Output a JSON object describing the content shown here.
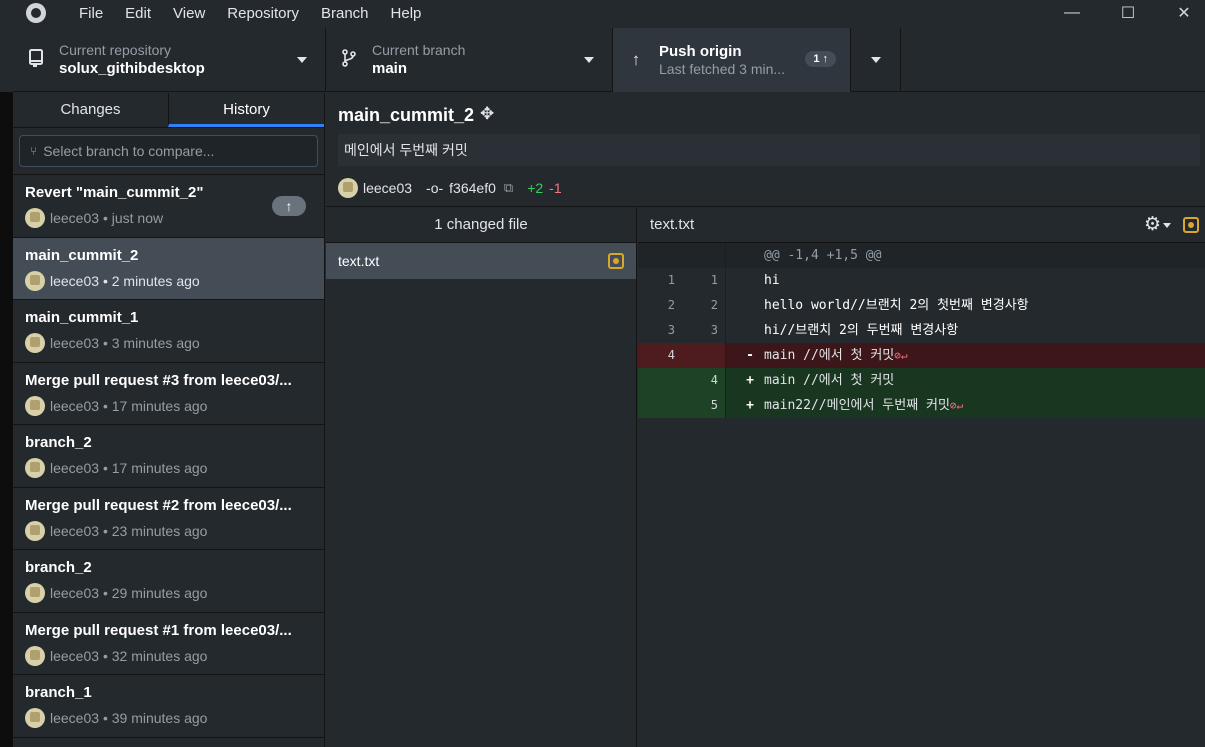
{
  "menu": [
    "File",
    "Edit",
    "View",
    "Repository",
    "Branch",
    "Help"
  ],
  "window_controls": {
    "minimize": "—",
    "maximize": "☐",
    "close": "✕"
  },
  "toolbar": {
    "repo_label": "Current repository",
    "repo_name": "solux_githibdesktop",
    "branch_label": "Current branch",
    "branch_name": "main",
    "push_label": "Push origin",
    "push_sub": "Last fetched 3 min...",
    "push_count": "1 ↑"
  },
  "sidebar": {
    "tabs": [
      "Changes",
      "History"
    ],
    "active_tab": "History",
    "compare_placeholder": "Select branch to compare...",
    "commits": [
      {
        "title": "Revert \"main_cummit_2\"",
        "author": "leece03",
        "time": "• just now",
        "unpushed": true
      },
      {
        "title": "main_cummit_2",
        "author": "leece03",
        "time": "• 2 minutes ago",
        "selected": true
      },
      {
        "title": "main_cummit_1",
        "author": "leece03",
        "time": "• 3 minutes ago"
      },
      {
        "title": "Merge pull request #3 from leece03/...",
        "author": "leece03",
        "time": "• 17 minutes ago"
      },
      {
        "title": "branch_2",
        "author": "leece03",
        "time": "• 17 minutes ago"
      },
      {
        "title": "Merge pull request #2 from leece03/...",
        "author": "leece03",
        "time": "• 23 minutes ago"
      },
      {
        "title": "branch_2",
        "author": "leece03",
        "time": "• 29 minutes ago"
      },
      {
        "title": "Merge pull request #1 from leece03/...",
        "author": "leece03",
        "time": "• 32 minutes ago"
      },
      {
        "title": "branch_1",
        "author": "leece03",
        "time": "• 39 minutes ago"
      }
    ]
  },
  "commit": {
    "title": "main_cummit_2",
    "description": "메인에서 두번째 커밋",
    "author": "leece03",
    "sha": "f364ef0",
    "additions": "+2",
    "deletions": "-1"
  },
  "files": {
    "header": "1 changed file",
    "items": [
      "text.txt"
    ]
  },
  "diff": {
    "filename": "text.txt",
    "lines": [
      {
        "type": "hunk",
        "old": "",
        "new": "",
        "sign": "",
        "text": "@@ -1,4 +1,5 @@",
        "nl": ""
      },
      {
        "type": "ctx",
        "old": "1",
        "new": "1",
        "sign": "",
        "text": "hi",
        "nl": ""
      },
      {
        "type": "ctx",
        "old": "2",
        "new": "2",
        "sign": "",
        "text": "hello world//브랜치 2의 첫번째 변경사항",
        "nl": ""
      },
      {
        "type": "ctx",
        "old": "3",
        "new": "3",
        "sign": "",
        "text": "hi//브랜치 2의 두번째 변경사항",
        "nl": ""
      },
      {
        "type": "del",
        "old": "4",
        "new": "",
        "sign": "-",
        "text": "main //에서 첫 커밋",
        "nl": "⊘↵"
      },
      {
        "type": "add",
        "old": "",
        "new": "4",
        "sign": "+",
        "text": "main //에서 첫 커밋",
        "nl": ""
      },
      {
        "type": "add",
        "old": "",
        "new": "5",
        "sign": "+",
        "text": "main22//메인에서 두번째 커밋",
        "nl": "⊘↵"
      }
    ]
  },
  "colors": {
    "accent": "#2f81f7",
    "added": "#34d058",
    "deleted": "#f97583",
    "modified": "#d7a72e"
  }
}
